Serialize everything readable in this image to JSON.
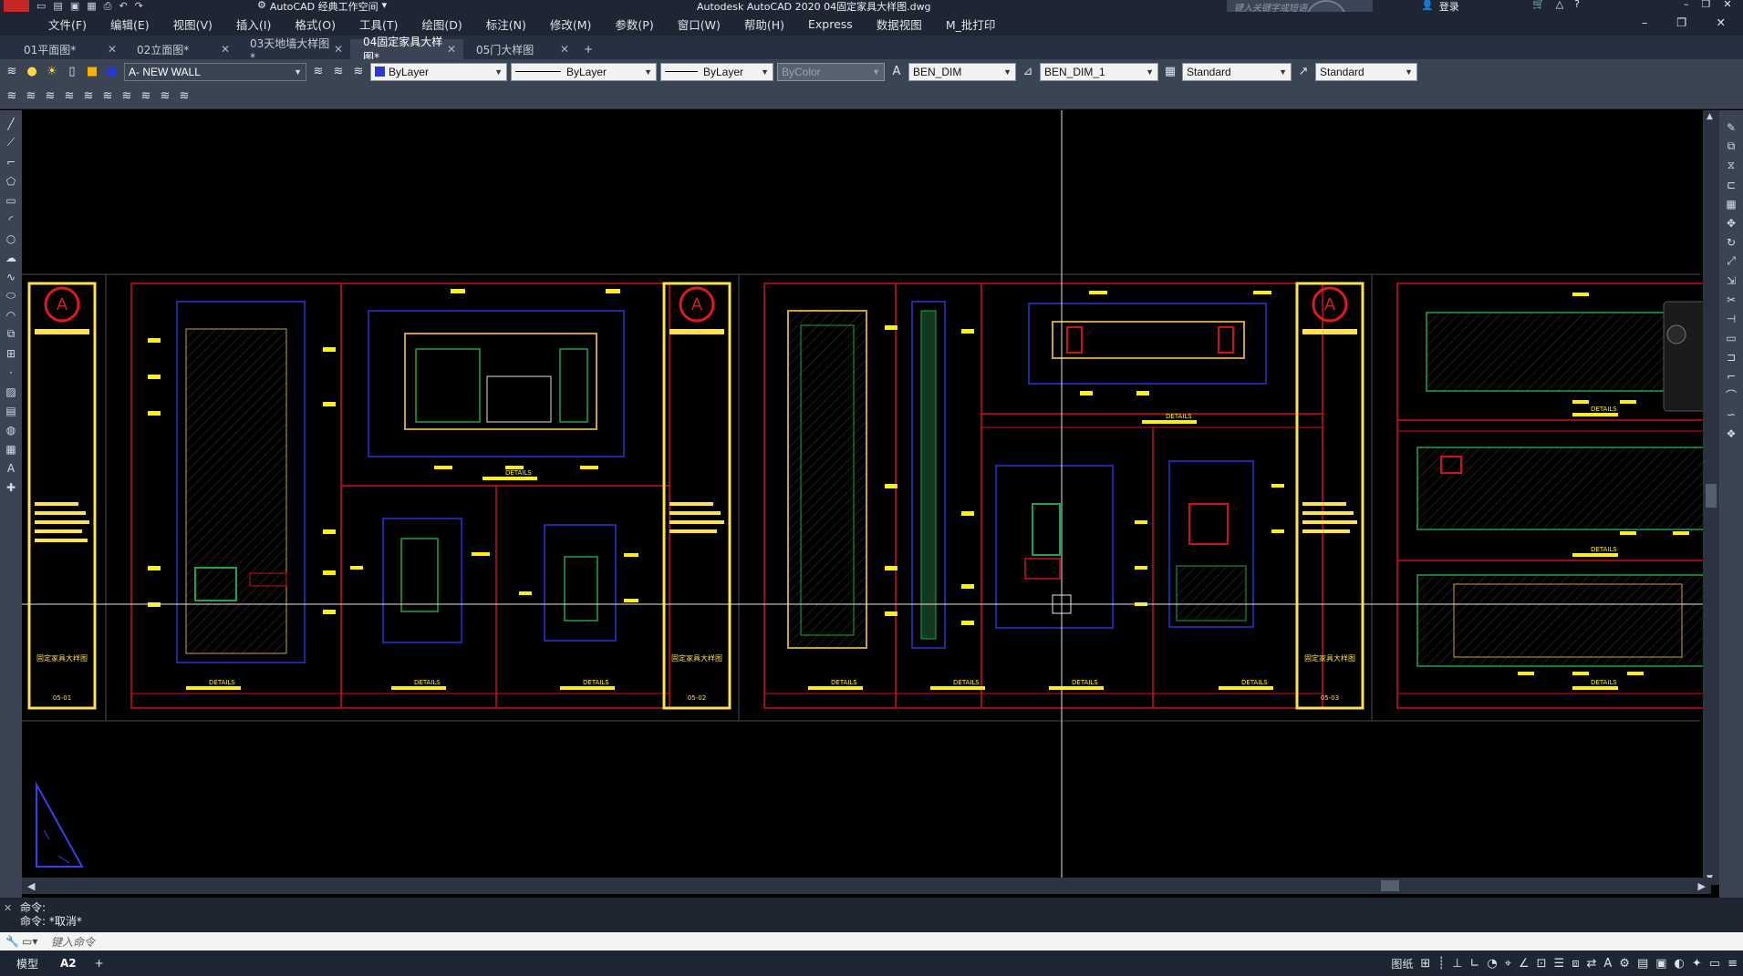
{
  "app": {
    "title": "Autodesk AutoCAD 2020    04固定家具大样图.dwg",
    "workspace": "AutoCAD 经典工作空间",
    "search_placeholder": "键入关键字或短语",
    "login": "登录",
    "avatar_badge": "A"
  },
  "menu": [
    "文件(F)",
    "编辑(E)",
    "视图(V)",
    "插入(I)",
    "格式(O)",
    "工具(T)",
    "绘图(D)",
    "标注(N)",
    "修改(M)",
    "参数(P)",
    "窗口(W)",
    "帮助(H)",
    "Express",
    "数据视图",
    "M_批打印"
  ],
  "tabs": [
    {
      "label": "01平面图*"
    },
    {
      "label": "02立面图*"
    },
    {
      "label": "03天地墙大样图*"
    },
    {
      "label": "04固定家具大样图*",
      "active": true
    },
    {
      "label": "05门大样图"
    }
  ],
  "toolbar": {
    "layer": "A- NEW WALL",
    "color": "ByLayer",
    "linetype": "ByLayer",
    "lineweight": "ByLayer",
    "plotstyle": "ByColor",
    "text_style": "BEN_DIM",
    "dim_style": "BEN_DIM_1",
    "table_style": "Standard",
    "mleader_style": "Standard"
  },
  "sheets": {
    "stamp_text": "固定家具大样图",
    "sheet_ids": [
      "05-01",
      "05-02",
      "05-03"
    ],
    "detail_label": "DETAILS"
  },
  "command": {
    "history": [
      "命令:",
      "命令: *取消*"
    ],
    "placeholder": "键入命令"
  },
  "status": {
    "tabs": [
      "模型",
      "A2"
    ],
    "right_label": "图纸"
  },
  "colors": {
    "sheet_border": "#ffe14a",
    "frame_red": "#d0101a",
    "frame_blue": "#2b36d6",
    "dim_yellow": "#fff200",
    "accent": "#2f6fd6"
  }
}
